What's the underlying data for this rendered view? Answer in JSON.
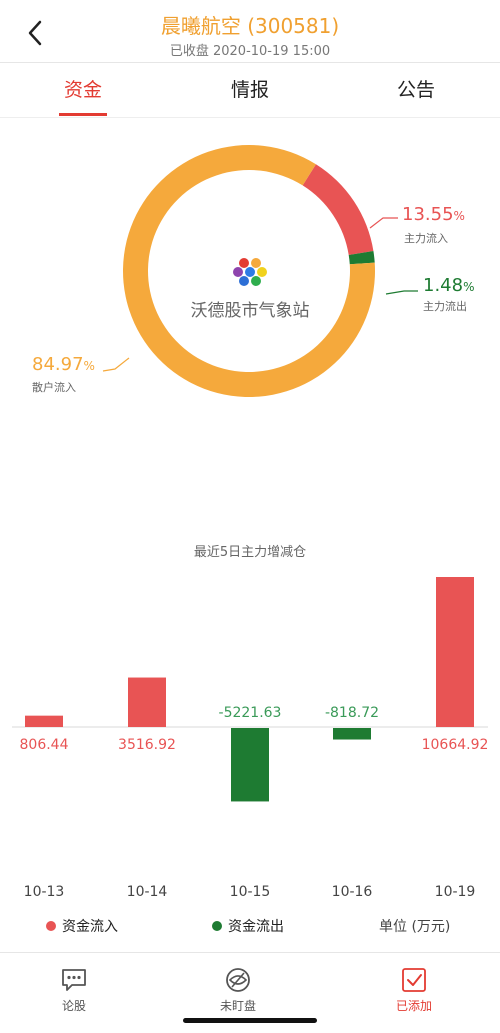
{
  "header": {
    "title": "晨曦航空 (300581)",
    "subtitle": "已收盘 2020-10-19 15:00"
  },
  "tabs": [
    {
      "label": "资金",
      "active": true
    },
    {
      "label": "情报",
      "active": false
    },
    {
      "label": "公告",
      "active": false
    }
  ],
  "donut": {
    "watermark": "沃德股市气象站",
    "segments": [
      {
        "name": "主力流入",
        "pct_value": "13.55",
        "value": 13.55,
        "color": "#e85454"
      },
      {
        "name": "主力流出",
        "pct_value": "1.48",
        "value": 1.48,
        "color": "#1e7b32"
      },
      {
        "name": "散户流入",
        "pct_value": "84.97",
        "value": 84.97,
        "color": "#f5a93c"
      }
    ],
    "pct_sign": "%"
  },
  "chart_data": {
    "type": "bar",
    "title": "最近5日主力增减仓",
    "categories": [
      "10-13",
      "10-14",
      "10-15",
      "10-16",
      "10-19"
    ],
    "values": [
      806.44,
      3516.92,
      -5221.63,
      -818.72,
      10664.92
    ],
    "value_labels": [
      "806.44",
      "3516.92",
      "-5221.63",
      "-818.72",
      "10664.92"
    ],
    "positive_color": "#e85454",
    "negative_color": "#1e7b32",
    "unit": "单位 (万元)"
  },
  "legend": {
    "inflow": "资金流入",
    "outflow": "资金流出",
    "unit": "单位 (万元)"
  },
  "bottom_nav": [
    {
      "label": "论股",
      "icon": "chat-icon"
    },
    {
      "label": "未盯盘",
      "icon": "eye-icon"
    },
    {
      "label": "已添加",
      "icon": "checkbox-icon"
    }
  ]
}
